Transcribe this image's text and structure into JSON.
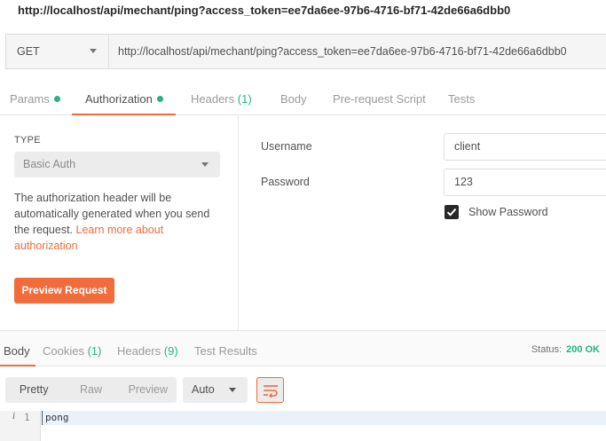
{
  "window": {
    "title": "http://localhost/api/mechant/ping?access_token=ee7da6ee-97b6-4716-bf71-42de66a6dbb0"
  },
  "request": {
    "method": "GET",
    "url": "http://localhost/api/mechant/ping?access_token=ee7da6ee-97b6-4716-bf71-42de66a6dbb0"
  },
  "request_tabs": {
    "params": "Params",
    "authorization": "Authorization",
    "headers": "Headers",
    "headers_count": "(1)",
    "body": "Body",
    "prerequest": "Pre-request Script",
    "tests": "Tests",
    "active": "Authorization"
  },
  "auth": {
    "type_label": "TYPE",
    "type_value": "Basic Auth",
    "description": "The authorization header will be automatically generated when you send the request. ",
    "learn_more": "Learn more about authorization",
    "preview_button": "Preview Request",
    "username_label": "Username",
    "username_value": "client",
    "password_label": "Password",
    "password_value": "123",
    "show_password_label": "Show Password",
    "show_password_checked": true
  },
  "response_tabs": {
    "body": "Body",
    "cookies": "Cookies",
    "cookies_count": "(1)",
    "headers": "Headers",
    "headers_count": "(9)",
    "test_results": "Test Results",
    "active": "Body"
  },
  "response_status": {
    "label": "Status:",
    "value": "200 OK"
  },
  "viewer": {
    "pretty": "Pretty",
    "raw": "Raw",
    "preview": "Preview",
    "active": "Pretty",
    "format": "Auto"
  },
  "editor": {
    "info_glyph": "i",
    "line_number": "1",
    "line_text": "pong"
  },
  "colors": {
    "accent": "#f26b3a",
    "success": "#26b47f"
  }
}
